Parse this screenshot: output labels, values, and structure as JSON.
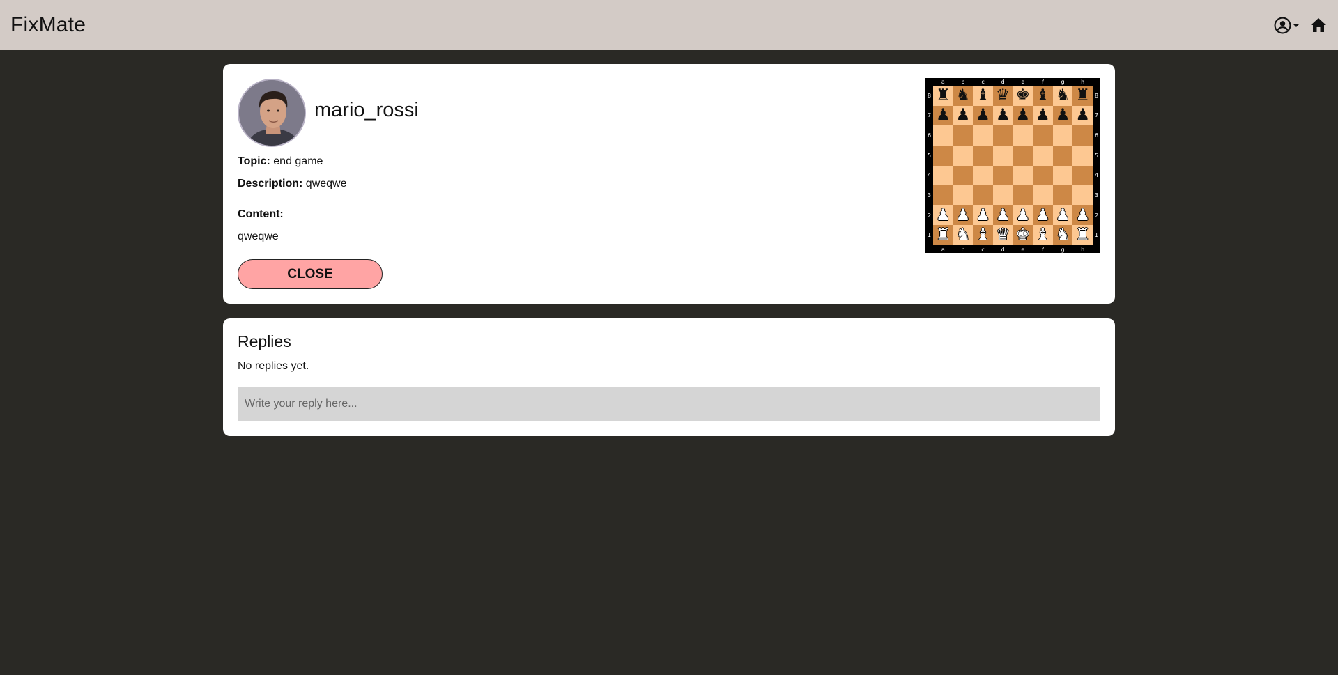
{
  "app": {
    "brand": "FixMate",
    "user_icon": "user-circle-icon",
    "home_icon": "home-icon"
  },
  "post": {
    "username": "mario_rossi",
    "topic_label": "Topic:",
    "topic": "end game",
    "description_label": "Description:",
    "description": "qweqwe",
    "content_label": "Content:",
    "content": "qweqwe",
    "close_label": "CLOSE"
  },
  "board": {
    "files": [
      "a",
      "b",
      "c",
      "d",
      "e",
      "f",
      "g",
      "h"
    ],
    "ranks": [
      "8",
      "7",
      "6",
      "5",
      "4",
      "3",
      "2",
      "1"
    ],
    "fen": "rnbqkbnr/pppppppp/8/8/8/8/PPPPPPPP/RNBQKBNR",
    "colors": {
      "light": "#fdc892",
      "dark": "#cd8846"
    }
  },
  "replies": {
    "title": "Replies",
    "empty_text": "No replies yet.",
    "input_placeholder": "Write your reply here..."
  },
  "colors": {
    "navbar": "#d3cbc6",
    "page_bg": "#2a2925",
    "close_button": "#ffa4a4",
    "input_bg": "#d5d5d5"
  }
}
